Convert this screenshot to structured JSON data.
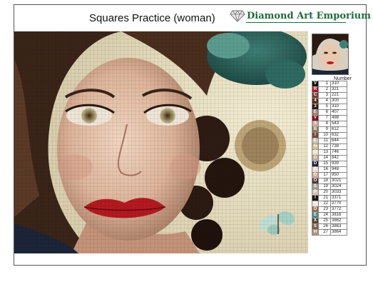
{
  "page": {
    "title": "Squares Practice (woman)",
    "brand": "Diamond Art Emporium",
    "brand_color": "#1f6b3a"
  },
  "legend": {
    "header": "Number",
    "rows": [
      {
        "sym": "V",
        "idx": "1",
        "num": "310",
        "color": "#1a1210"
      },
      {
        "sym": "R",
        "idx": "2",
        "num": "321",
        "color": "#b3142a"
      },
      {
        "sym": "C",
        "idx": "3",
        "num": "221",
        "color": "#7a3a33"
      },
      {
        "sym": "4",
        "idx": "4",
        "num": "300",
        "color": "#5a2a14"
      },
      {
        "sym": "3",
        "idx": "5",
        "num": "310",
        "color": "#2a1a12"
      },
      {
        "sym": "E",
        "idx": "6",
        "num": "407",
        "color": "#a67a6a"
      },
      {
        "sym": "V",
        "idx": "7",
        "num": "498",
        "color": "#8a1020"
      },
      {
        "sym": "S",
        "idx": "8",
        "num": "543",
        "color": "#c9a895"
      },
      {
        "sym": "B",
        "idx": "9",
        "num": "612",
        "color": "#8d7a58"
      },
      {
        "sym": "I",
        "idx": "10",
        "num": "632",
        "color": "#7a4a3a"
      },
      {
        "sym": "E",
        "idx": "11",
        "num": "644",
        "color": "#c8c0a8"
      },
      {
        "sym": "N",
        "idx": "12",
        "num": "738",
        "color": "#d8b88a"
      },
      {
        "sym": "O",
        "idx": "13",
        "num": "746",
        "color": "#e8dfc0"
      },
      {
        "sym": "G",
        "idx": "14",
        "num": "842",
        "color": "#c4a888"
      },
      {
        "sym": "D",
        "idx": "15",
        "num": "939",
        "color": "#1a2040"
      },
      {
        "sym": "Z",
        "idx": "16",
        "num": "948",
        "color": "#f0d8c8"
      },
      {
        "sym": "O",
        "idx": "17",
        "num": "950",
        "color": "#d4a890"
      },
      {
        "sym": "O",
        "idx": "18",
        "num": "3021",
        "color": "#4a3e34"
      },
      {
        "sym": "S",
        "idx": "19",
        "num": "3024",
        "color": "#a89c88"
      },
      {
        "sym": "P",
        "idx": "20",
        "num": "3033",
        "color": "#cfc4b0"
      },
      {
        "sym": "I",
        "idx": "21",
        "num": "3371",
        "color": "#1e140c"
      },
      {
        "sym": "N",
        "idx": "22",
        "num": "3770",
        "color": "#f4e4d4"
      },
      {
        "sym": "O",
        "idx": "23",
        "num": "3772",
        "color": "#9a6a52"
      },
      {
        "sym": "E",
        "idx": "24",
        "num": "3816",
        "color": "#4a8a80"
      },
      {
        "sym": "X",
        "idx": "25",
        "num": "3862",
        "color": "#5a4430"
      },
      {
        "sym": "S",
        "idx": "26",
        "num": "3863",
        "color": "#7a5e48"
      },
      {
        "sym": "H",
        "idx": "27",
        "num": "3864",
        "color": "#b09478"
      }
    ]
  }
}
